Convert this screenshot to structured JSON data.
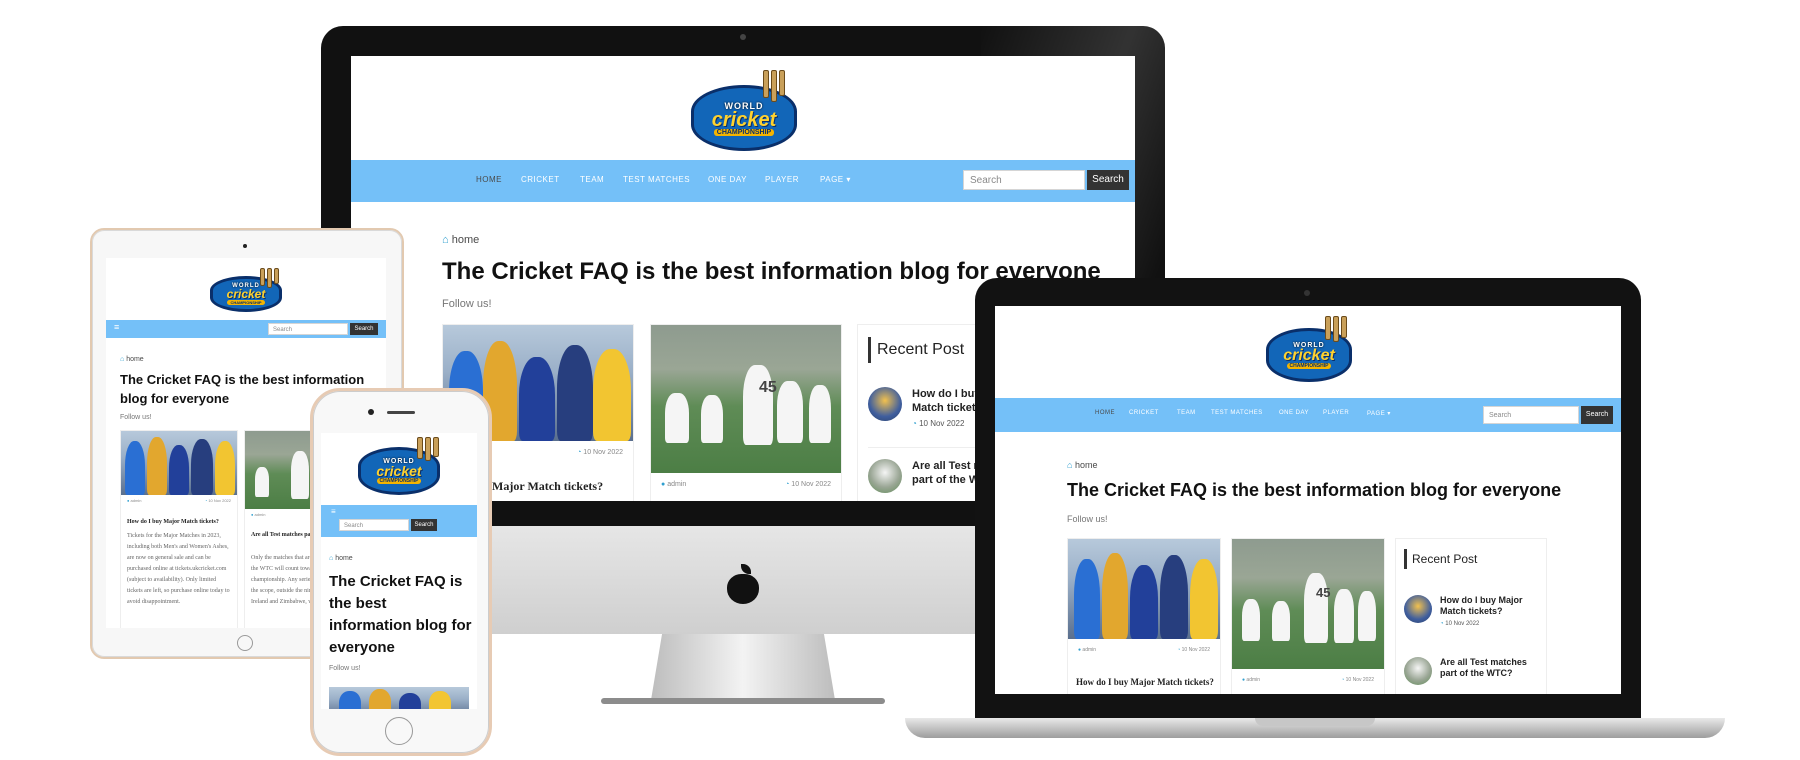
{
  "logo": {
    "top": "WORLD",
    "middle": "cricket",
    "bottom": "CHAMPIONSHIP"
  },
  "nav": {
    "items": [
      "HOME",
      "CRICKET",
      "TEAM",
      "TEST MATCHES",
      "ONE DAY",
      "PLAYER",
      "PAGE ▾"
    ],
    "search_placeholder": "Search",
    "search_button": "Search",
    "menu_icon": "≡"
  },
  "breadcrumb": {
    "icon": "home-icon",
    "label": "home"
  },
  "page": {
    "title": "The Cricket FAQ is the best information blog for everyone",
    "title_mobile_lines": [
      "The Cricket FAQ is",
      "the best",
      "information blog for",
      "everyone"
    ],
    "title_tablet_lines": [
      "The Cricket FAQ is the best information",
      "blog for everyone"
    ],
    "follow": "Follow us!"
  },
  "posts": [
    {
      "author": "admin",
      "date": "10 Nov 2022",
      "title": "How do I buy Major Match tickets?",
      "excerpt": "Tickets for the Major Matches in 2023, including both Men's and Women's Ashes, are now on general sale and can be purchased online at tickets.ukcricket.com (subject to availability). Only limited tickets are left, so purchase online today to avoid disappointment."
    },
    {
      "author": "admin",
      "date": "10 Nov 2022",
      "title": "Are all Test matches part of the WTC?",
      "excerpt": "Only the matches that are played as part of the WTC will count towards the championship. Any series that falls outside the scope, outside the nine, Afghanistan, Ireland and Zimbabwe, will not count."
    }
  ],
  "tablet_post_titles": [
    "How do I buy Major Match tickets?",
    "Are all Test matches part of the WTC?"
  ],
  "sidebar": {
    "heading": "Recent Post",
    "items": [
      {
        "title": "How do I buy Major Match tickets?",
        "date": "10 Nov 2022"
      },
      {
        "title": "Are all Test matches part of the WTC?",
        "date": ""
      }
    ],
    "imac_items": [
      {
        "title": [
          "How do I buy",
          "Match tickets"
        ],
        "date": "10 Nov 2022"
      },
      {
        "title": [
          "Are all Test r",
          "part of the W"
        ],
        "date": ""
      }
    ],
    "laptop_items": [
      {
        "title": [
          "How do I buy Major",
          "Match tickets?"
        ],
        "date": "10 Nov 2022"
      },
      {
        "title": [
          "Are all Test matches",
          "part of the WTC?"
        ],
        "date": ""
      }
    ]
  },
  "imac_post_title_cut": "o I buy Major Match tickets?",
  "colors": {
    "nav": "#74c0f8",
    "accent": "#2f9fcf",
    "dark_button": "#333333"
  }
}
